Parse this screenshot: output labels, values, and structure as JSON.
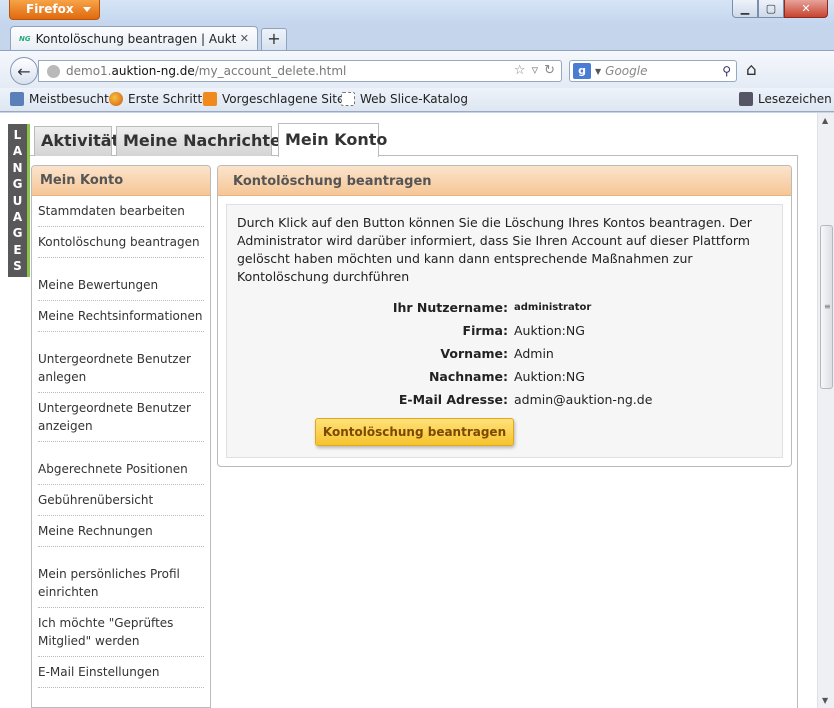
{
  "browser": {
    "app_button": "Firefox",
    "tab_title": "Kontolöschung beantragen | Auktion:N...",
    "tab_favicon": "NG",
    "url_prefix": "demo1.",
    "url_domain": "auktion-ng.de",
    "url_path": "/my_account_delete.html",
    "search_placeholder": "Google",
    "bookmarks": [
      "Meistbesucht",
      "Erste Schritte",
      "Vorgeschlagene Sites",
      "Web Slice-Katalog"
    ],
    "bookmarks_menu": "Lesezeichen"
  },
  "language_tab": [
    "L",
    "A",
    "N",
    "G",
    "U",
    "A",
    "G",
    "E",
    "S"
  ],
  "tabs": [
    "Aktivität",
    "Meine Nachrichten",
    "Mein Konto"
  ],
  "sidebar": {
    "title": "Mein Konto",
    "items": [
      "Stammdaten bearbeiten",
      "Kontolöschung beantragen",
      "Meine Bewertungen",
      "Meine Rechtsinformationen",
      "Untergeordnete Benutzer anlegen",
      "Untergeordnete Benutzer anzeigen",
      "Abgerechnete Positionen",
      "Gebührenübersicht",
      "Meine Rechnungen",
      "Mein persönliches Profil einrichten",
      "Ich möchte \"Geprüftes Mitglied\" werden",
      "E-Mail Einstellungen"
    ]
  },
  "panel": {
    "title": "Kontolöschung beantragen",
    "description": "Durch Klick auf den Button können Sie die Löschung Ihres Kontos beantragen. Der Administrator wird darüber informiert, dass Sie Ihren Account auf dieser Plattform gelöscht haben möchten und kann dann entsprechende Maßnahmen zur Kontolöschung durchführen",
    "fields": [
      {
        "label": "Ihr Nutzername:",
        "value": "administrator"
      },
      {
        "label": "Firma:",
        "value": "Auktion:NG"
      },
      {
        "label": "Vorname:",
        "value": "Admin"
      },
      {
        "label": "Nachname:",
        "value": "Auktion:NG"
      },
      {
        "label": "E-Mail Adresse:",
        "value": "admin@auktion-ng.de"
      }
    ],
    "button_label": "Kontolöschung beantragen"
  }
}
